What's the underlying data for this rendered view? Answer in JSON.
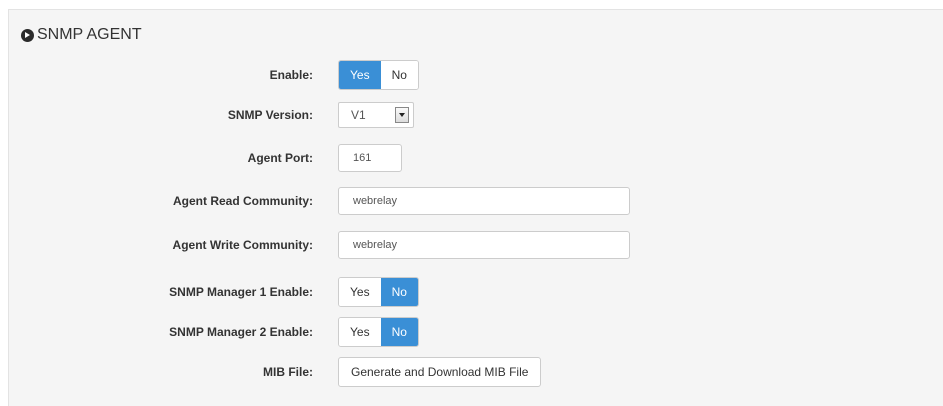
{
  "panel": {
    "title": "SNMP AGENT",
    "icon": "circle-arrow-right-icon"
  },
  "colors": {
    "accent": "#3a8fd6",
    "panel_bg": "#f5f5f5",
    "border": "#cccccc"
  },
  "fields": {
    "enable": {
      "label": "Enable:",
      "yes": "Yes",
      "no": "No",
      "selected": "Yes"
    },
    "snmp_version": {
      "label": "SNMP Version:",
      "value": "V1"
    },
    "agent_port": {
      "label": "Agent Port:",
      "value": "161"
    },
    "read_community": {
      "label": "Agent Read Community:",
      "value": "webrelay"
    },
    "write_community": {
      "label": "Agent Write Community:",
      "value": "webrelay"
    },
    "manager1": {
      "label": "SNMP Manager 1 Enable:",
      "yes": "Yes",
      "no": "No",
      "selected": "No"
    },
    "manager2": {
      "label": "SNMP Manager 2 Enable:",
      "yes": "Yes",
      "no": "No",
      "selected": "No"
    },
    "mib_file": {
      "label": "MIB File:",
      "button": "Generate and Download MIB File"
    }
  }
}
